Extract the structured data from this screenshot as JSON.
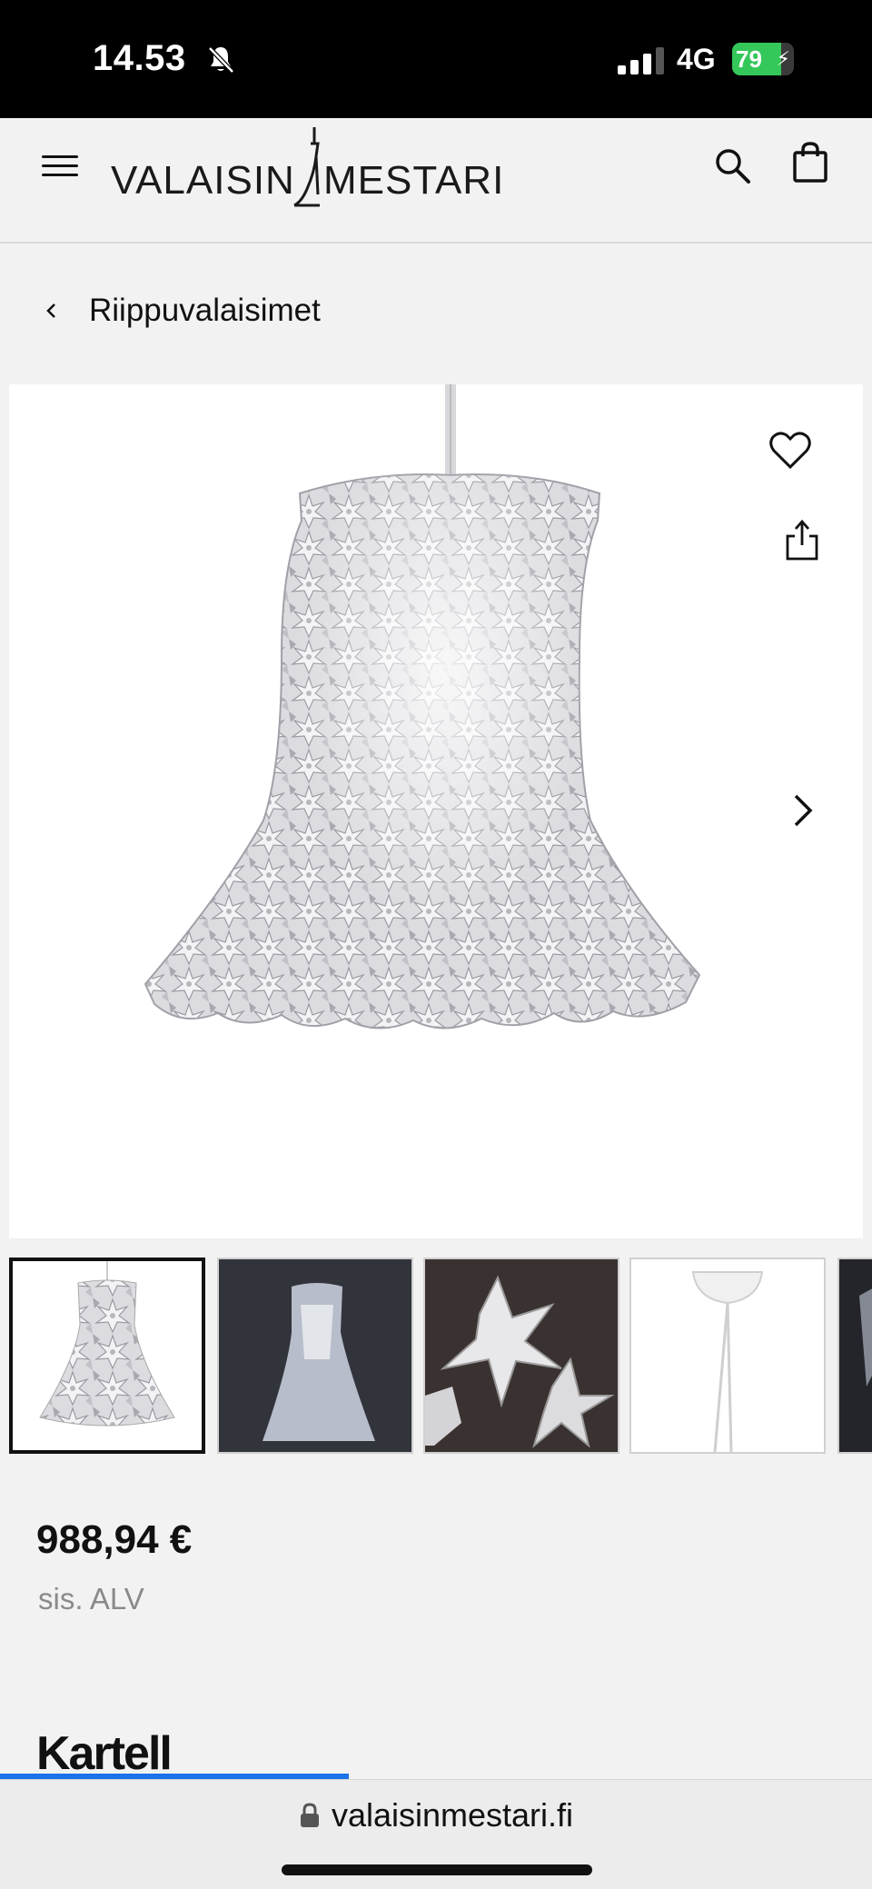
{
  "status_bar": {
    "time": "14.53",
    "network": "4G",
    "battery": "79",
    "battery_level": 0.79
  },
  "header": {
    "logo_left": "VALAISIN",
    "logo_right": "MESTARI",
    "icons": [
      "menu-icon",
      "search-icon",
      "shopping-bag-icon"
    ]
  },
  "breadcrumb": {
    "back_icon": "chevron-left-icon",
    "label": "Riippuvalaisimet"
  },
  "gallery": {
    "main_icons": [
      "heart-icon",
      "share-icon",
      "chevron-right-icon"
    ],
    "thumbnail_count_visible": 5,
    "active_index": 0
  },
  "product": {
    "price": "988,94 €",
    "vat_note": "sis. ALV",
    "brand": "Kartell"
  },
  "browser": {
    "url": "valaisinmestari.fi",
    "load_progress": 0.4
  }
}
